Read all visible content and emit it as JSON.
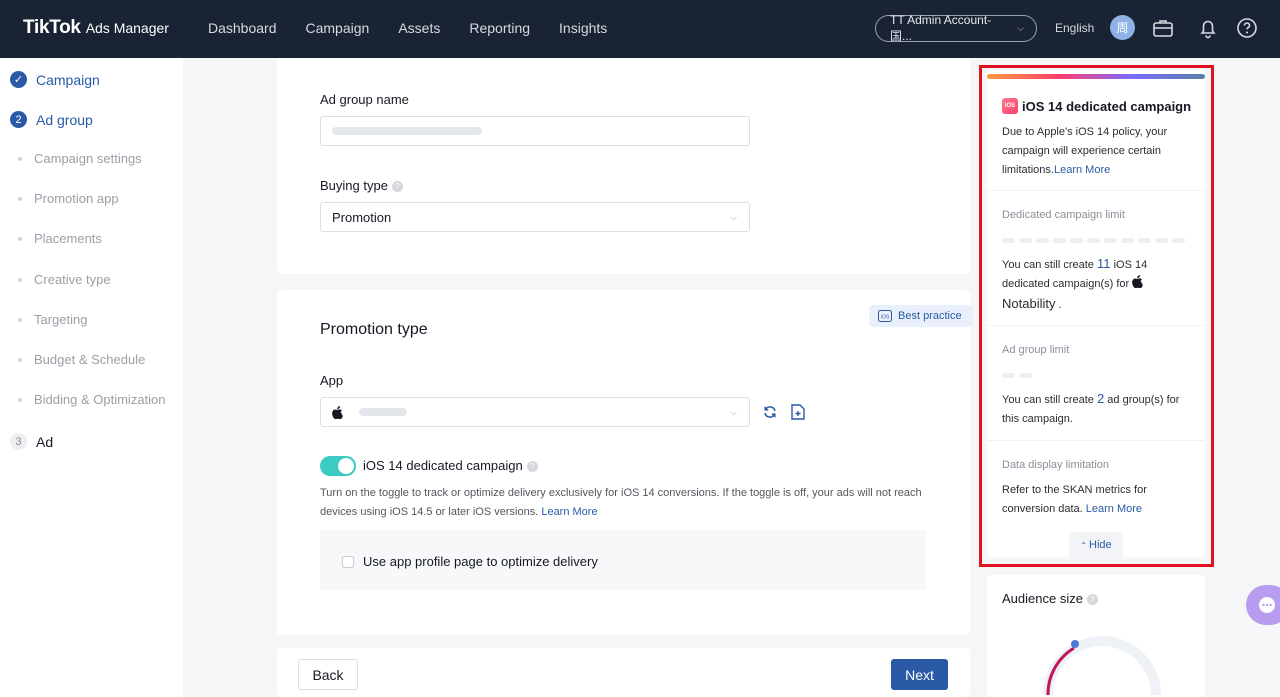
{
  "topnav": {
    "brand": "TikTok",
    "brand_sub": "Ads Manager",
    "links": [
      "Dashboard",
      "Campaign",
      "Assets",
      "Reporting",
      "Insights"
    ],
    "account": "TT Admin Account-国...",
    "language": "English",
    "avatar_initial": "周"
  },
  "sidebar": {
    "steps": [
      {
        "label": "Campaign",
        "status": "done"
      },
      {
        "label": "Ad group",
        "number": "2",
        "status": "current"
      },
      {
        "label": "Ad",
        "number": "3",
        "status": "todo"
      }
    ],
    "substeps": [
      "Campaign settings",
      "Promotion app",
      "Placements",
      "Creative type",
      "Targeting",
      "Budget & Schedule",
      "Bidding & Optimization"
    ]
  },
  "adgroup": {
    "name_label": "Ad group name",
    "buying_label": "Buying type",
    "buying_value": "Promotion"
  },
  "promotion": {
    "title": "Promotion type",
    "best_practice": "Best practice",
    "app_label": "App",
    "ios_label": "iOS 14 dedicated campaign",
    "ios_desc": "Turn on the toggle to track or optimize delivery exclusively for iOS 14 conversions. If the toggle is off, your ads will not reach devices using iOS 14.5 or later iOS versions.",
    "learn_more": "Learn More",
    "profile_label": "Use app profile page to optimize delivery",
    "toggle_on": true
  },
  "panel": {
    "badge": "iOS",
    "title": "iOS 14 dedicated campaign",
    "intro": "Due to Apple's iOS 14 policy, your campaign will experience certain limitations.",
    "learn_more": "Learn More",
    "campaign_limit_title": "Dedicated campaign limit",
    "campaign_text_pre": "You can still create",
    "campaign_count": "11",
    "campaign_text_post": "iOS 14 dedicated campaign(s) for",
    "app_name": "Notability",
    "app_suffix": ".",
    "adgroup_limit_title": "Ad group limit",
    "adgroup_text_pre": "You can still create",
    "adgroup_count": "2",
    "adgroup_text_post": "ad group(s) for this campaign.",
    "display_title": "Data display limitation",
    "display_text": "Refer to the SKAN metrics for conversion data.",
    "display_learn_more": "Learn More",
    "hide": "Hide"
  },
  "audience": {
    "title": "Audience size"
  },
  "footer": {
    "back": "Back",
    "next": "Next"
  },
  "colors": {
    "accent": "#2a5aa6",
    "toggle": "#3ccbc0",
    "highlight": "#e0121d",
    "nav_bg": "#1a2333"
  }
}
